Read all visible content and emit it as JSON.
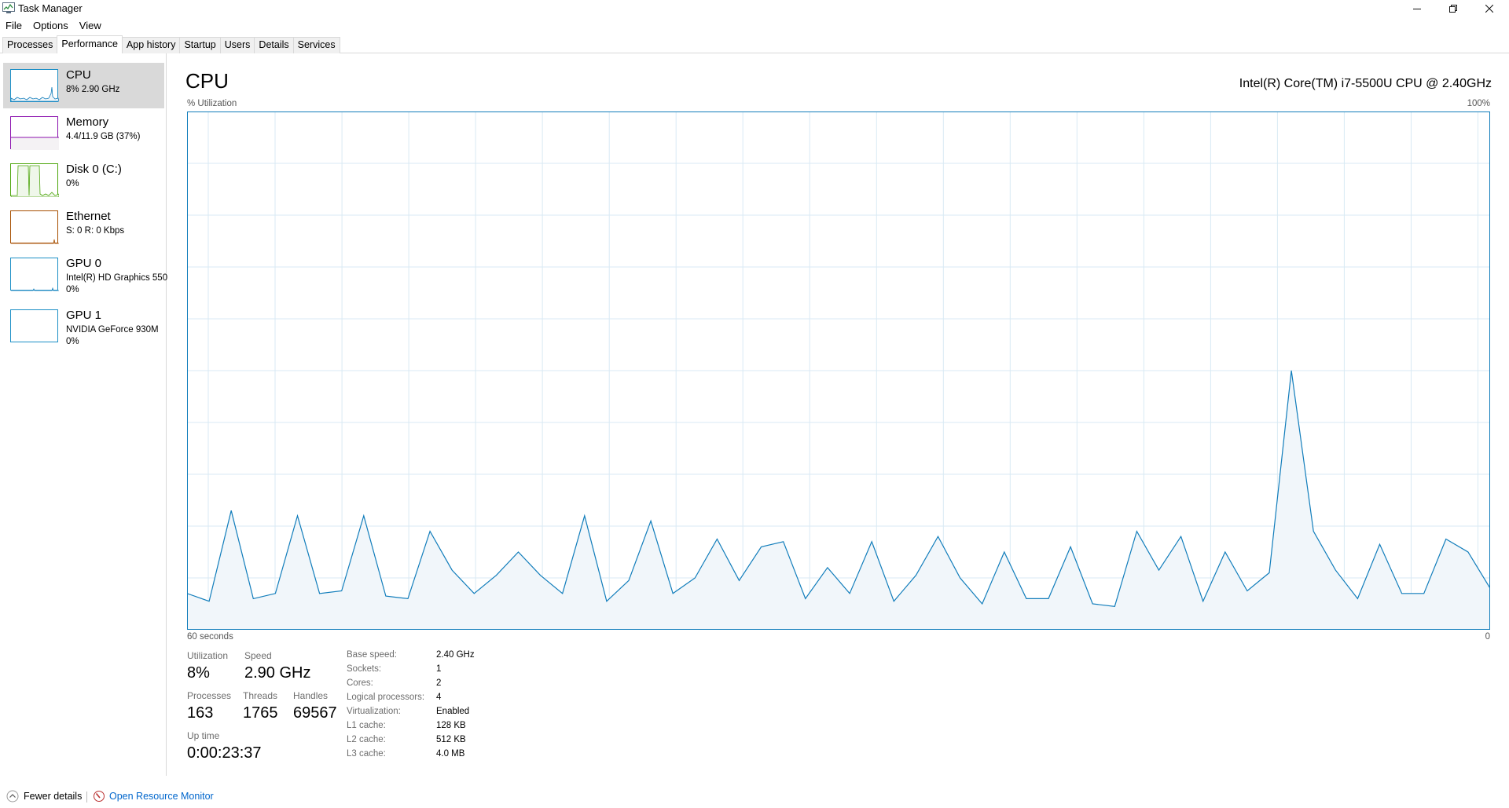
{
  "window": {
    "title": "Task Manager",
    "controls": {
      "minimize": "minimize",
      "restore": "restore",
      "close": "close"
    }
  },
  "menu": {
    "items": [
      "File",
      "Options",
      "View"
    ]
  },
  "tabs": [
    "Processes",
    "Performance",
    "App history",
    "Startup",
    "Users",
    "Details",
    "Services"
  ],
  "active_tab": "Performance",
  "sidebar": {
    "items": [
      {
        "title": "CPU",
        "sub1": "8% 2.90 GHz",
        "sub2": "",
        "color": "#1c8fc6",
        "selected": true
      },
      {
        "title": "Memory",
        "sub1": "4.4/11.9 GB (37%)",
        "sub2": "",
        "color": "#8b12ae",
        "selected": false
      },
      {
        "title": "Disk 0 (C:)",
        "sub1": "0%",
        "sub2": "",
        "color": "#4da60c",
        "selected": false
      },
      {
        "title": "Ethernet",
        "sub1": "S: 0 R: 0 Kbps",
        "sub2": "",
        "color": "#a74f01",
        "selected": false
      },
      {
        "title": "GPU 0",
        "sub1": "Intel(R) HD Graphics 550",
        "sub2": "0%",
        "color": "#1c8fc6",
        "selected": false
      },
      {
        "title": "GPU 1",
        "sub1": "NVIDIA GeForce 930M",
        "sub2": "0%",
        "color": "#1c8fc6",
        "selected": false
      }
    ]
  },
  "main": {
    "heading": "CPU",
    "model": "Intel(R) Core(TM) i7-5500U CPU @ 2.40GHz",
    "util_label": "% Utilization",
    "util_max": "100%",
    "x_left": "60 seconds",
    "x_right": "0",
    "graph_color": "#117dbb",
    "graph_fill": "#f1f6fa",
    "grid_color": "#d9eaf4"
  },
  "chart_data": {
    "type": "area",
    "ylabel": "% Utilization",
    "ylim": [
      0,
      100
    ],
    "xlim": [
      60,
      0
    ],
    "grid": true,
    "values": [
      7,
      5.5,
      23,
      6,
      7,
      22,
      7,
      7.5,
      22,
      6.5,
      6,
      19,
      11.5,
      7,
      10.5,
      15,
      10.5,
      7,
      22,
      5.5,
      9.5,
      21,
      7,
      10,
      17.5,
      9.5,
      16,
      17,
      6,
      12,
      7,
      17,
      5.5,
      10.5,
      18,
      10,
      5,
      15,
      6,
      6,
      16,
      5,
      4.5,
      19,
      11.5,
      18,
      5.5,
      15,
      7.5,
      11,
      50,
      19,
      11.5,
      6,
      16.5,
      7,
      7,
      17.5,
      15,
      8
    ]
  },
  "stats": {
    "utilization": {
      "label": "Utilization",
      "value": "8%"
    },
    "speed": {
      "label": "Speed",
      "value": "2.90 GHz"
    },
    "processes": {
      "label": "Processes",
      "value": "163"
    },
    "threads": {
      "label": "Threads",
      "value": "1765"
    },
    "handles": {
      "label": "Handles",
      "value": "69567"
    },
    "uptime": {
      "label": "Up time",
      "value": "0:00:23:37"
    }
  },
  "details": [
    {
      "label": "Base speed:",
      "value": "2.40 GHz"
    },
    {
      "label": "Sockets:",
      "value": "1"
    },
    {
      "label": "Cores:",
      "value": "2"
    },
    {
      "label": "Logical processors:",
      "value": "4"
    },
    {
      "label": "Virtualization:",
      "value": "Enabled"
    },
    {
      "label": "L1 cache:",
      "value": "128 KB"
    },
    {
      "label": "L2 cache:",
      "value": "512 KB"
    },
    {
      "label": "L3 cache:",
      "value": "4.0 MB"
    }
  ],
  "footer": {
    "fewer": "Fewer details",
    "resmon": "Open Resource Monitor"
  }
}
